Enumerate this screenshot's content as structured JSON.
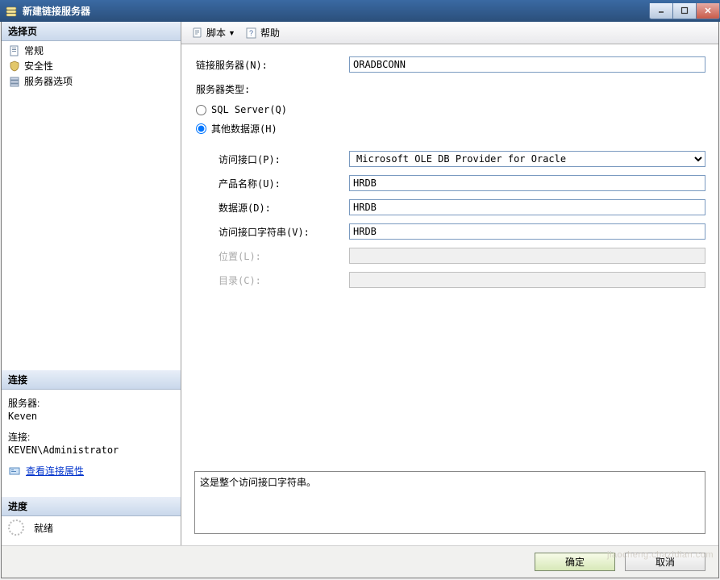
{
  "window": {
    "title": "新建链接服务器"
  },
  "sidebar": {
    "selectPageHeader": "选择页",
    "items": [
      {
        "label": "常规"
      },
      {
        "label": "安全性"
      },
      {
        "label": "服务器选项"
      }
    ],
    "connectionHeader": "连接",
    "serverLabel": "服务器:",
    "serverValue": "Keven",
    "connLabel": "连接:",
    "connValue": "KEVEN\\Administrator",
    "viewConnLink": "查看连接属性",
    "progressHeader": "进度",
    "progressStatus": "就绪"
  },
  "toolbar": {
    "script": "脚本",
    "help": "帮助"
  },
  "form": {
    "linkedServerLabel": "链接服务器(N):",
    "linkedServerValue": "ORADBCONN",
    "serverTypeLabel": "服务器类型:",
    "radioSqlServer": "SQL Server(Q)",
    "radioOther": "其他数据源(H)",
    "providerLabel": "访问接口(P):",
    "providerValue": "Microsoft OLE DB Provider for Oracle",
    "productNameLabel": "产品名称(U):",
    "productNameValue": "HRDB",
    "dataSourceLabel": "数据源(D):",
    "dataSourceValue": "HRDB",
    "providerStringLabel": "访问接口字符串(V):",
    "providerStringValue": "HRDB",
    "locationLabel": "位置(L):",
    "locationValue": "",
    "catalogLabel": "目录(C):",
    "catalogValue": ""
  },
  "message": "这是整个访问接口字符串。",
  "buttons": {
    "ok": "确定",
    "cancel": "取消"
  },
  "radioSelected": "other"
}
